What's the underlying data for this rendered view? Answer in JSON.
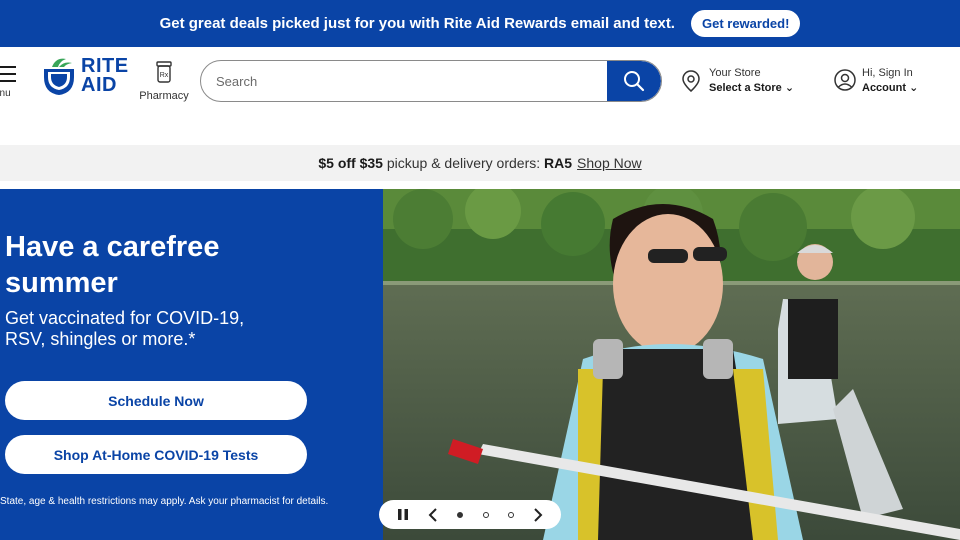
{
  "topbar": {
    "message": "Get great deals picked just for you with Rite Aid Rewards email and text.",
    "button": "Get rewarded!"
  },
  "header": {
    "menu_label": "enu",
    "logo_line1": "RITE",
    "logo_line2": "AID",
    "pharmacy_label": "Pharmacy",
    "search_placeholder": "Search",
    "store_label": "Your Store",
    "store_value": "Select a Store",
    "account_label": "Hi, Sign In",
    "account_value": "Account"
  },
  "promo": {
    "amount": "$5 off $35",
    "text": "pickup & delivery orders:",
    "code": "RA5",
    "link": "Shop Now"
  },
  "hero": {
    "title_line1": "Have a carefree",
    "title_line2": "summer",
    "subtitle_line1": "Get vaccinated for COVID-19,",
    "subtitle_line2": "RSV, shingles or more.*",
    "button1": "Schedule Now",
    "button2": "Shop At-Home COVID-19 Tests",
    "disclaimer": "State, age & health restrictions may apply. Ask your pharmacist for details."
  },
  "carousel": {
    "slides": 3,
    "active_slide": 1
  },
  "colors": {
    "brand_blue": "#0a44a6",
    "promo_bg": "#f2f2f2"
  }
}
